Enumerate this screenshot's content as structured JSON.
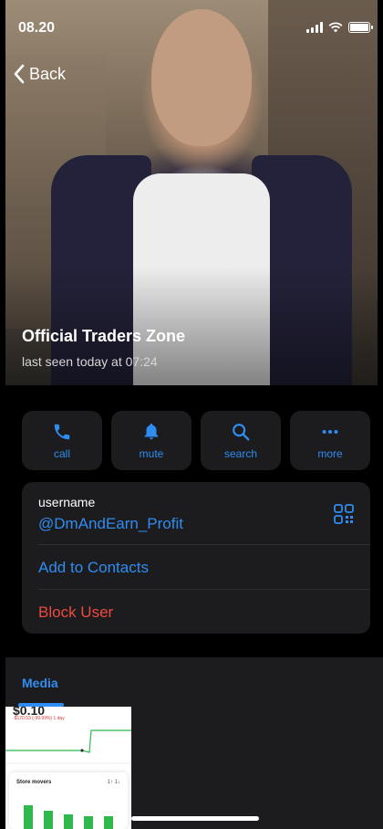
{
  "status_bar": {
    "time": "08.20"
  },
  "nav": {
    "back_label": "Back"
  },
  "profile": {
    "name": "Official Traders Zone",
    "last_seen": "last seen today at 07:24"
  },
  "actions": [
    {
      "label": "call",
      "icon": "phone-icon"
    },
    {
      "label": "mute",
      "icon": "bell-icon"
    },
    {
      "label": "search",
      "icon": "search-icon"
    },
    {
      "label": "more",
      "icon": "more-icon"
    }
  ],
  "info": {
    "username_label": "username",
    "username_value": "@DmAndEarn_Profit",
    "add_contacts": "Add to Contacts",
    "block_user": "Block User"
  },
  "media": {
    "tab_label": "Media",
    "thumbnail": {
      "price": "$0.10",
      "change": "-$170.53 (-99.99%) 1 day",
      "card_title": "Store movers",
      "card_controls": "1↑  1↓"
    }
  },
  "colors": {
    "accent": "#2f8cf0",
    "destructive": "#ec4a3f",
    "card_bg": "#1c1c1e"
  }
}
